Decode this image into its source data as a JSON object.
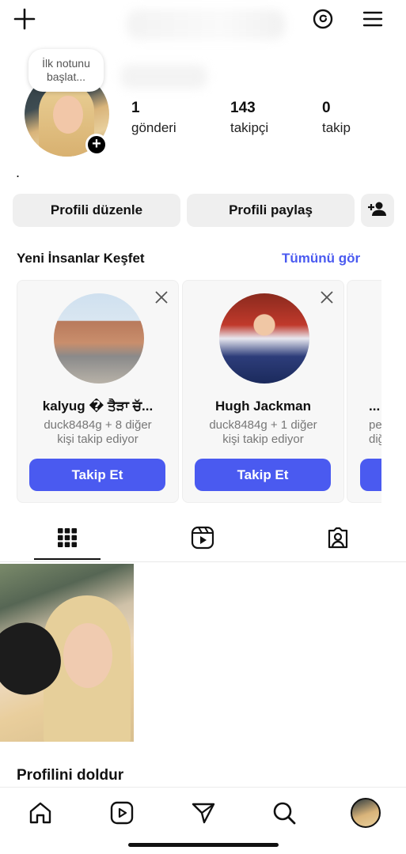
{
  "header": {
    "add_icon": "plus-icon",
    "threads_icon": "threads-icon",
    "menu_icon": "hamburger-menu-icon"
  },
  "profile": {
    "note_text": "İlk notunu başlat...",
    "stats": [
      {
        "value": "1",
        "label": "gönderi"
      },
      {
        "value": "143",
        "label": "takipçi"
      },
      {
        "value": "0",
        "label": "takip"
      }
    ],
    "bio": "."
  },
  "actions": {
    "edit_profile": "Profili düzenle",
    "share_profile": "Profili paylaş"
  },
  "discover": {
    "title": "Yeni İnsanlar Keşfet",
    "see_all": "Tümünü gör",
    "cards": [
      {
        "name": "kalyug � ਤੈੜਾ ਚੱ...",
        "sub_line1": "duck8484g + 8 diğer",
        "sub_line2": "kişi takip ediyor",
        "follow": "Takip Et"
      },
      {
        "name": "Hugh Jackman",
        "sub_line1": "duck8484g + 1 diğer",
        "sub_line2": "kişi takip ediyor",
        "follow": "Takip Et"
      },
      {
        "name": "...",
        "sub_line1": "pe",
        "sub_line2": "diğ"
      }
    ]
  },
  "tabs": [
    "grid-icon",
    "reels-icon",
    "tagged-icon"
  ],
  "fill_profile_title": "Profilini doldur",
  "bottom_nav": [
    "home-icon",
    "reels-icon",
    "send-icon",
    "search-icon",
    "profile-avatar"
  ],
  "colors": {
    "accent": "#4a5af0",
    "button_gray": "#efefef"
  }
}
